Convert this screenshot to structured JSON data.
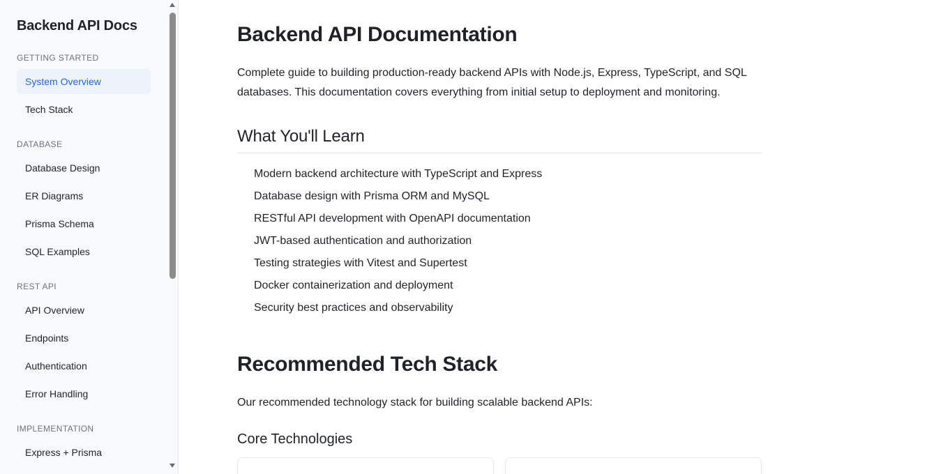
{
  "sidebar": {
    "brand": "Backend API Docs",
    "sections": [
      {
        "label": "GETTING STARTED",
        "items": [
          {
            "label": "System Overview",
            "active": true
          },
          {
            "label": "Tech Stack",
            "active": false
          }
        ]
      },
      {
        "label": "DATABASE",
        "items": [
          {
            "label": "Database Design",
            "active": false
          },
          {
            "label": "ER Diagrams",
            "active": false
          },
          {
            "label": "Prisma Schema",
            "active": false
          },
          {
            "label": "SQL Examples",
            "active": false
          }
        ]
      },
      {
        "label": "REST API",
        "items": [
          {
            "label": "API Overview",
            "active": false
          },
          {
            "label": "Endpoints",
            "active": false
          },
          {
            "label": "Authentication",
            "active": false
          },
          {
            "label": "Error Handling",
            "active": false
          }
        ]
      },
      {
        "label": "IMPLEMENTATION",
        "items": [
          {
            "label": "Express + Prisma",
            "active": false
          }
        ]
      }
    ]
  },
  "main": {
    "title": "Backend API Documentation",
    "intro": "Complete guide to building production-ready backend APIs with Node.js, Express, TypeScript, and SQL databases. This documentation covers everything from initial setup to deployment and monitoring.",
    "learn_heading": "What You'll Learn",
    "learn_items": [
      "Modern backend architecture with TypeScript and Express",
      "Database design with Prisma ORM and MySQL",
      "RESTful API development with OpenAPI documentation",
      "JWT-based authentication and authorization",
      "Testing strategies with Vitest and Supertest",
      "Docker containerization and deployment",
      "Security best practices and observability"
    ],
    "stack_title": "Recommended Tech Stack",
    "stack_intro": "Our recommended technology stack for building scalable backend APIs:",
    "core_heading": "Core Technologies"
  },
  "colors": {
    "accent": "#2563eb",
    "active_bg": "#eef2fb",
    "sidebar_bg": "#f8f9fa"
  }
}
